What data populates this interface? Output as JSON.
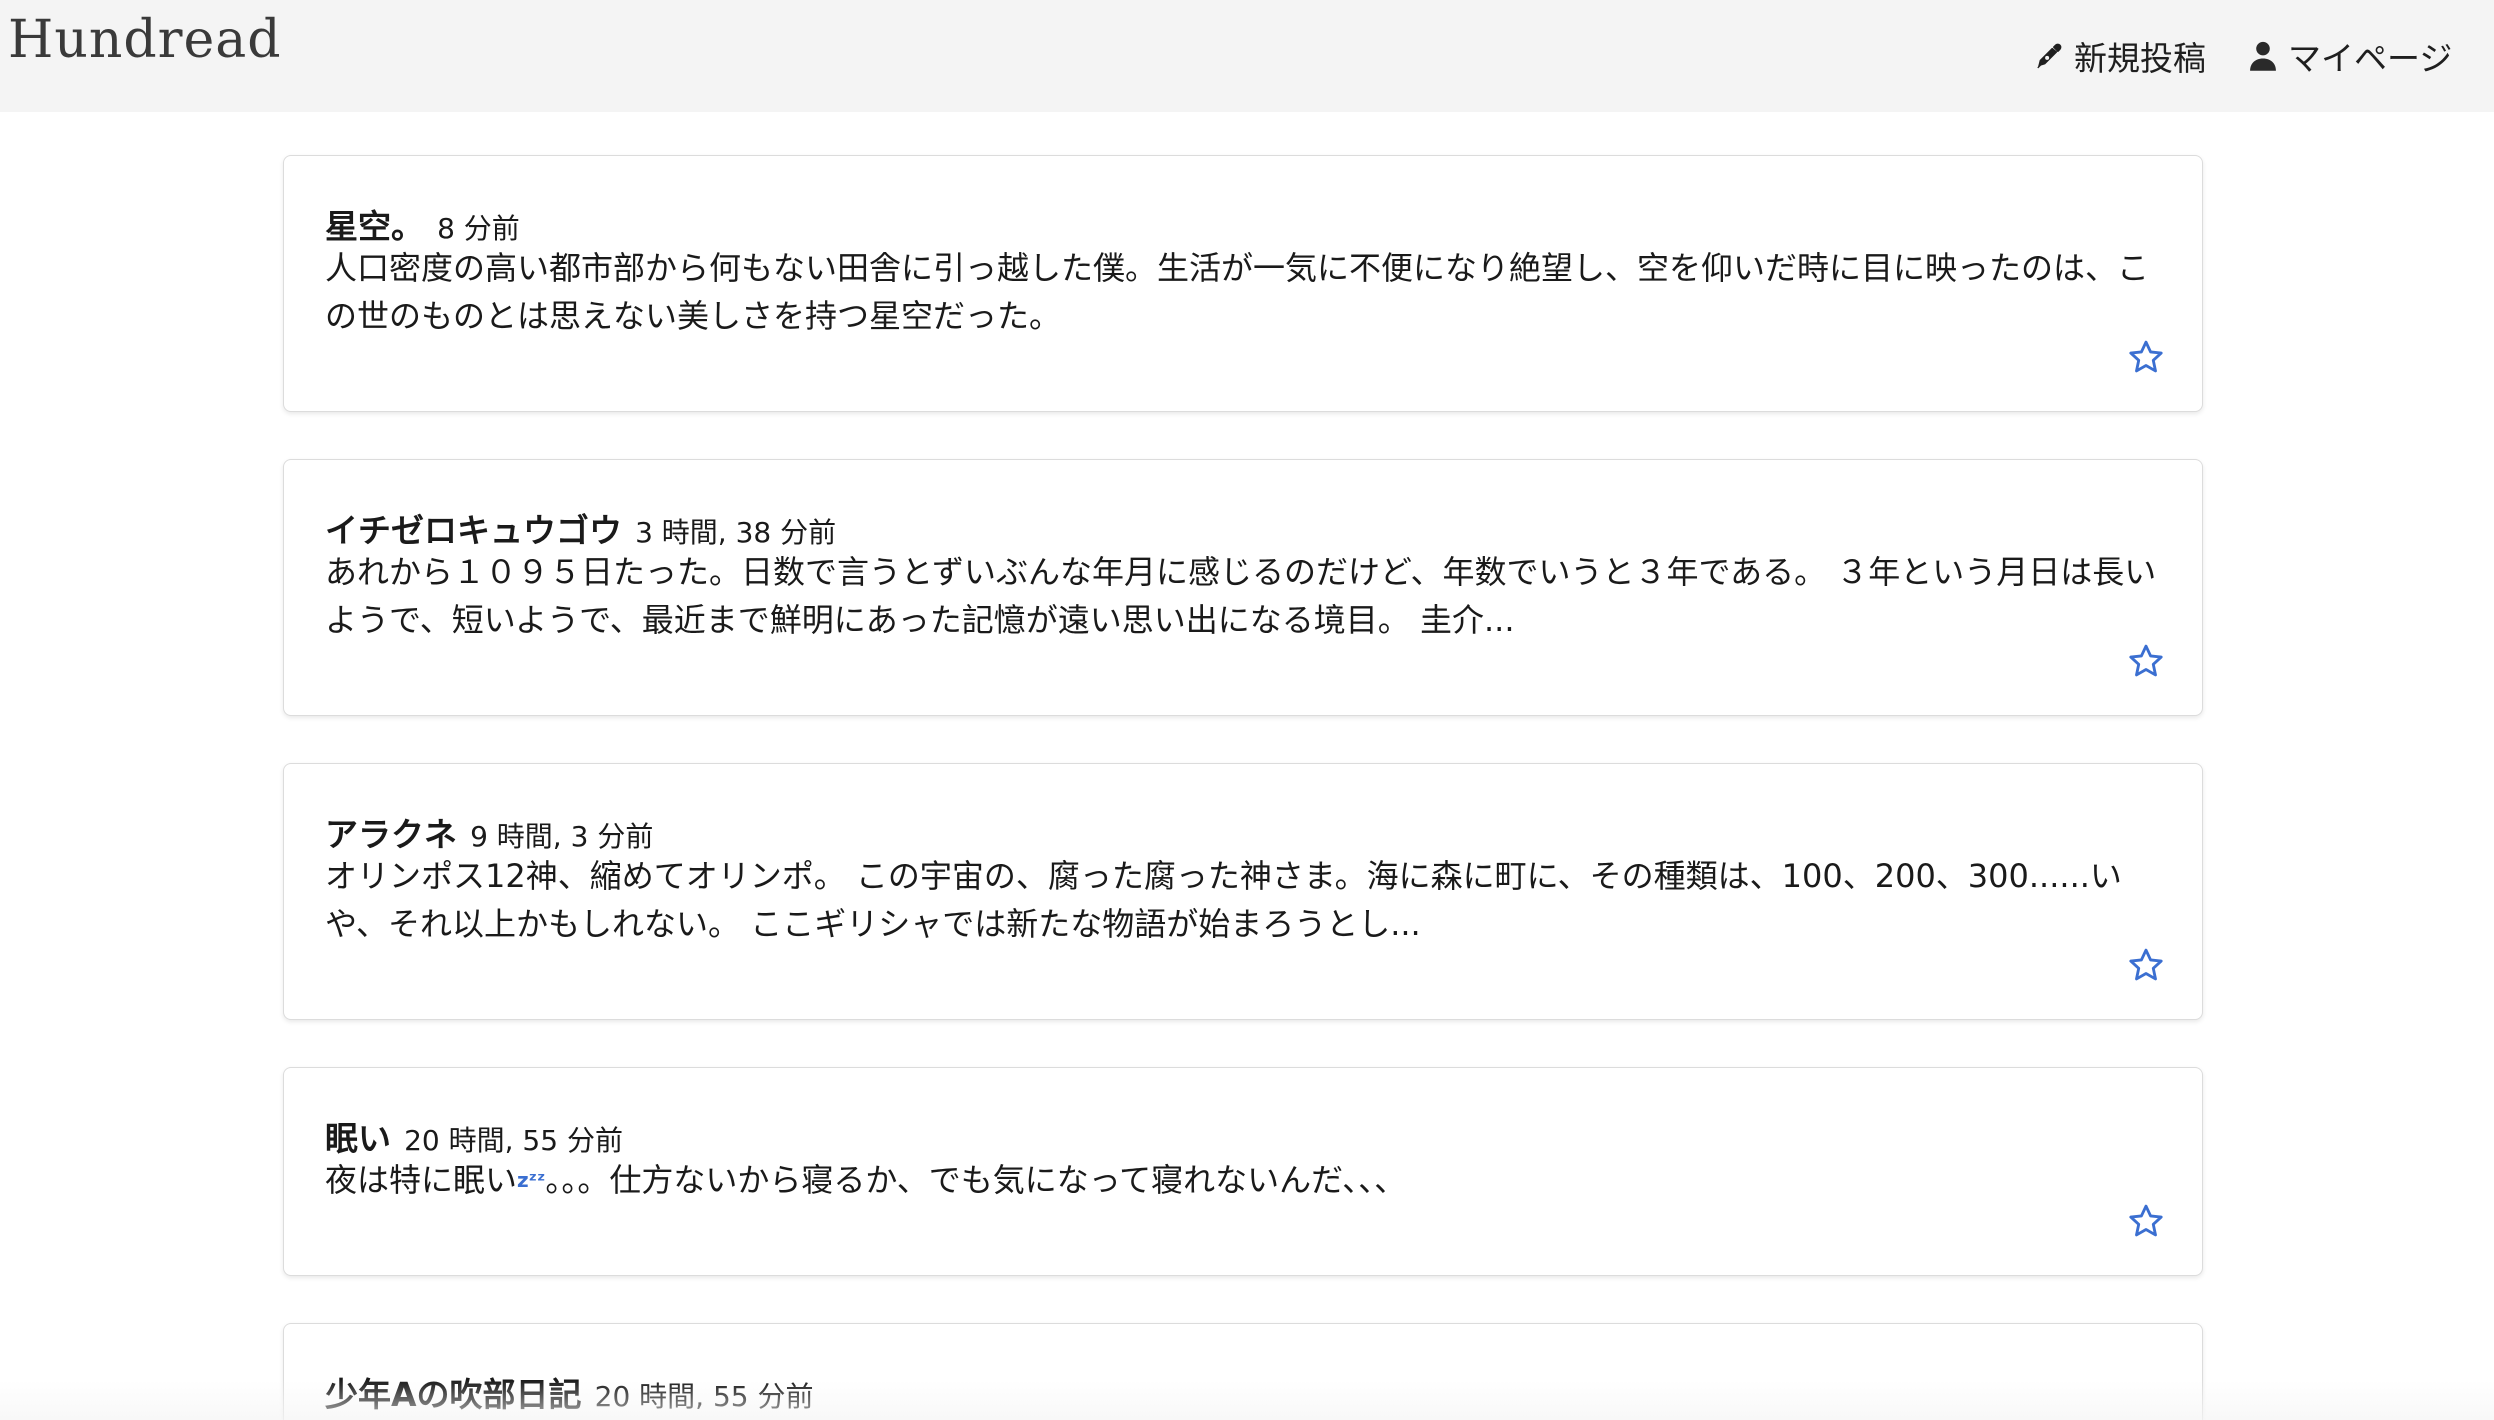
{
  "header": {
    "logo": "Hundread",
    "nav_new_post": "新規投稿",
    "nav_mypage": "マイページ",
    "icons": [
      "pen-icon",
      "user-icon"
    ]
  },
  "posts": [
    {
      "title": "星空。",
      "time": "8 分前",
      "body": "人口密度の高い都市部から何もない田舎に引っ越した僕。生活が一気に不便になり絶望し、空を仰いだ時に目に映ったのは、この世のものとは思えない美しさを持つ星空だった。"
    },
    {
      "title": "イチゼロキュウゴウ",
      "time": "3 時間, 38 分前",
      "body": "あれから１０９５日たった。日数で言うとずいぶんな年月に感じるのだけど、年数でいうと３年である。 ３年という月日は長いようで、短いようで、最近まで鮮明にあった記憶が遠い思い出になる境目。 圭介..."
    },
    {
      "title": "アラクネ",
      "time": "9 時間, 3 分前",
      "body": "オリンポス12神、縮めてオリンポ。 この宇宙の、腐った腐った神さま。海に森に町に、その種類は、100、200、300......いや、それ以上かもしれない。 ここギリシャでは新たな物語が始まろうとし..."
    },
    {
      "title": "眠い",
      "time": "20 時間, 55 分前",
      "body_before": "夜は特に眠い",
      "body_emoji": "zᶻᶻ",
      "body_after": "。。。仕方ないから寝るか、でも気になって寝れないんだ、、、"
    },
    {
      "title": "少年Aの吹部日記",
      "time": "20 時間, 55 分前"
    }
  ],
  "colors": {
    "header_bg": "#f4f4f4",
    "star": "#3b6fd1"
  },
  "icons": {
    "favorite": "star-outline-icon"
  }
}
